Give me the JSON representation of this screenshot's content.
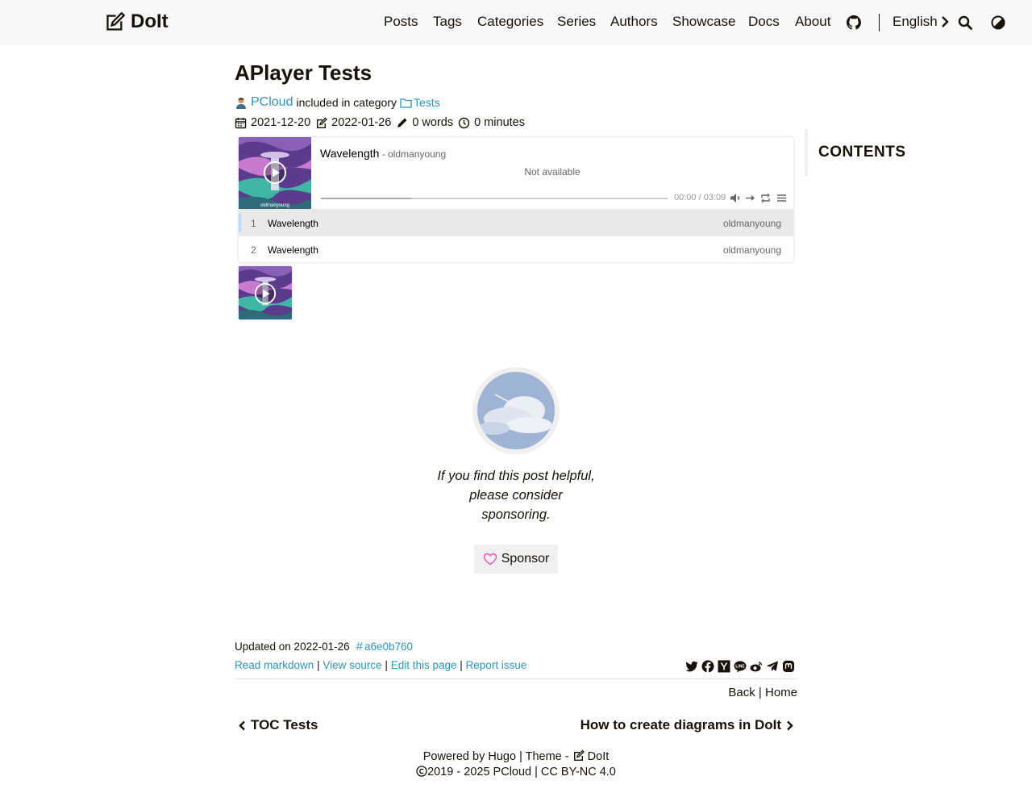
{
  "header": {
    "logo_text": "DoIt",
    "nav": [
      "Posts",
      "Tags",
      "Categories",
      "Series",
      "Authors",
      "Showcase",
      "Docs",
      "About"
    ],
    "language": "English"
  },
  "post": {
    "title": "APlayer Tests",
    "author": "PCloud",
    "included_text": "included in category",
    "category": "Tests",
    "published": "2021-12-20",
    "modified": "2022-01-26",
    "words": "0 words",
    "reading_time": "0 minutes"
  },
  "toc": {
    "title": "CONTENTS"
  },
  "player": {
    "title": "Wavelength",
    "author": " - oldmanyoung",
    "lrc": "Not available",
    "time": "00:00 / 03:09",
    "loaded_fraction": 0.26,
    "playlist": [
      {
        "index": "1",
        "name": "Wavelength",
        "artist": "oldmanyoung"
      },
      {
        "index": "2",
        "name": "Wavelength",
        "artist": "oldmanyoung"
      }
    ]
  },
  "sponsor": {
    "text": "If you find this post helpful, please consider sponsoring.",
    "button": "Sponsor"
  },
  "post_footer": {
    "updated": "Updated on 2022-01-26",
    "commit": "a6e0b760",
    "read_markdown": "Read markdown",
    "view_source": "View source",
    "edit_page": "Edit this page",
    "report_issue": "Report issue",
    "sep": "|",
    "back": "Back",
    "home": "Home"
  },
  "pager": {
    "prev": "TOC Tests",
    "next": "How to create diagrams in DoIt"
  },
  "site_footer": {
    "powered_by": "Powered by",
    "hugo": "Hugo",
    "theme": "| Theme -",
    "theme_name": "DoIt",
    "copyright": "2019 - 2025",
    "owner": "PCloud",
    "license": "| CC BY-NC 4.0"
  },
  "colors": {
    "accent": "#2d96bd",
    "header_bg": "#f8f8f8",
    "sponsor_heart": "#e95ea8"
  }
}
